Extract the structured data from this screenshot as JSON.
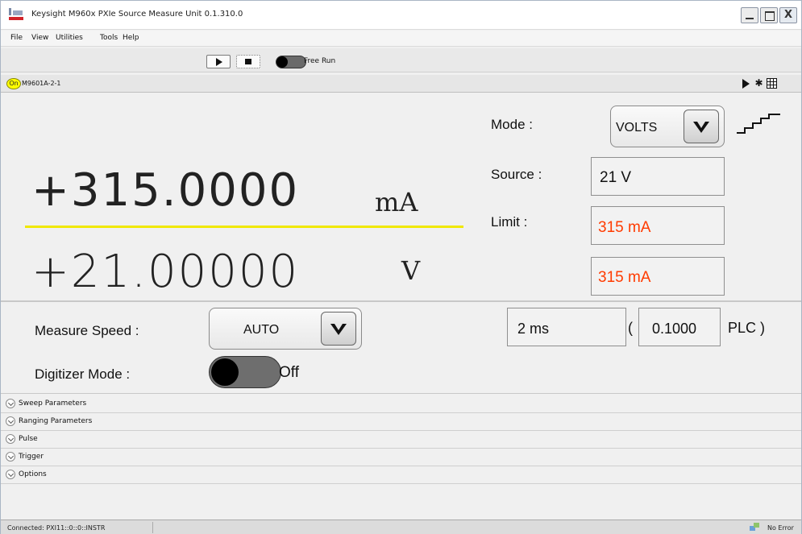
{
  "window": {
    "title": "Keysight M960x PXIe Source Measure Unit 0.1.310.0",
    "close_label": "X"
  },
  "menu": [
    "File",
    "View",
    "Utilities",
    "Tools",
    "Help"
  ],
  "run_toolbar": {
    "free_run_label": "Free Run",
    "free_run_state": "off"
  },
  "instrument": {
    "on_label": "On",
    "name": "M9601A-2-1",
    "header_icons": [
      "play-icon",
      "gear-icon",
      "grid-icon"
    ]
  },
  "readout": {
    "current_value": "+315.0000",
    "current_unit": "mA",
    "voltage_value": "+21.00000",
    "voltage_unit": "V"
  },
  "controls": {
    "mode_label": "Mode :",
    "mode_value": "VOLTS",
    "source_label": "Source :",
    "source_value": "21  V",
    "limit_label": "Limit :",
    "limit_value": "315 mA",
    "limit_value_2": "315 mA",
    "limit_color": "#ff3b00"
  },
  "measure": {
    "speed_label": "Measure Speed :",
    "speed_value": "AUTO",
    "aperture_time": "2 ms",
    "paren_open": "(",
    "plc_value": "0.1000",
    "plc_label": "PLC )",
    "digitizer_label": "Digitizer Mode :",
    "digitizer_state": "Off"
  },
  "sections": [
    {
      "label": "Sweep Parameters"
    },
    {
      "label": "Ranging Parameters"
    },
    {
      "label": "Pulse"
    },
    {
      "label": "Trigger"
    },
    {
      "label": "Options"
    }
  ],
  "status": {
    "connection": "Connected: PXI11::0::0::INSTR",
    "error": "No Error"
  },
  "colors": {
    "accent_yellow": "#f0e800",
    "on_indicator": "#ffff00",
    "limit_text": "#ff3b00",
    "brand_red": "#d2232a"
  }
}
